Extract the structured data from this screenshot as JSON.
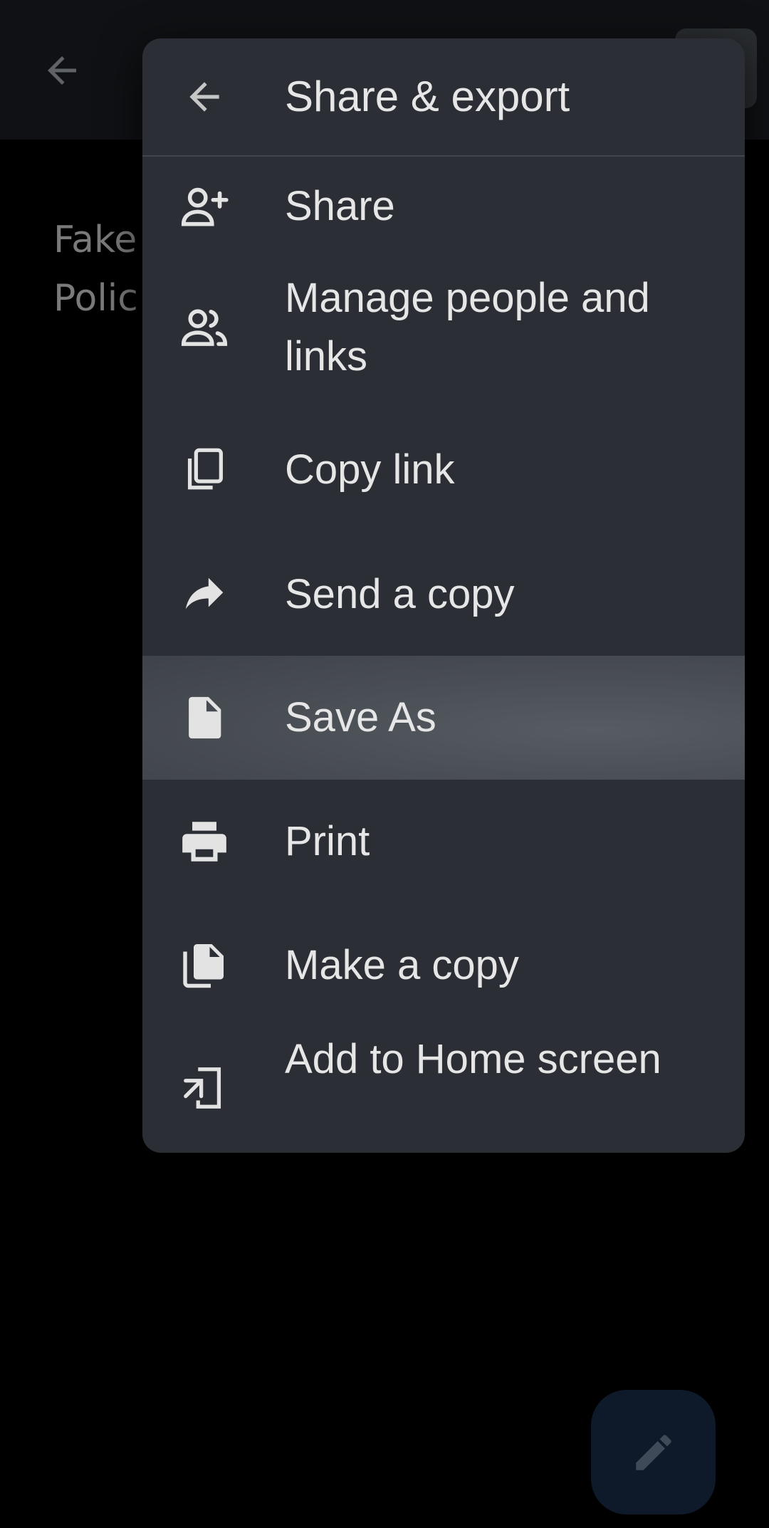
{
  "background": {
    "document_title_lines": [
      "Fake",
      "Polic"
    ]
  },
  "menu": {
    "title": "Share & export",
    "items": [
      {
        "label": "Share",
        "icon": "person-add-icon"
      },
      {
        "label": "Manage people and links",
        "icon": "people-icon"
      },
      {
        "label": "Copy link",
        "icon": "copy-icon"
      },
      {
        "label": "Send a copy",
        "icon": "forward-arrow-icon"
      },
      {
        "label": "Save As",
        "icon": "file-icon",
        "highlighted": true
      },
      {
        "label": "Print",
        "icon": "printer-icon"
      },
      {
        "label": "Make a copy",
        "icon": "files-icon"
      },
      {
        "label": "Add to Home screen",
        "icon": "add-to-home-icon"
      }
    ]
  },
  "colors": {
    "menu_bg": "#2b2f35",
    "highlight_bg": "#4b5056",
    "text": "#e6e6e6",
    "fab_bg": "#0e1a29"
  }
}
